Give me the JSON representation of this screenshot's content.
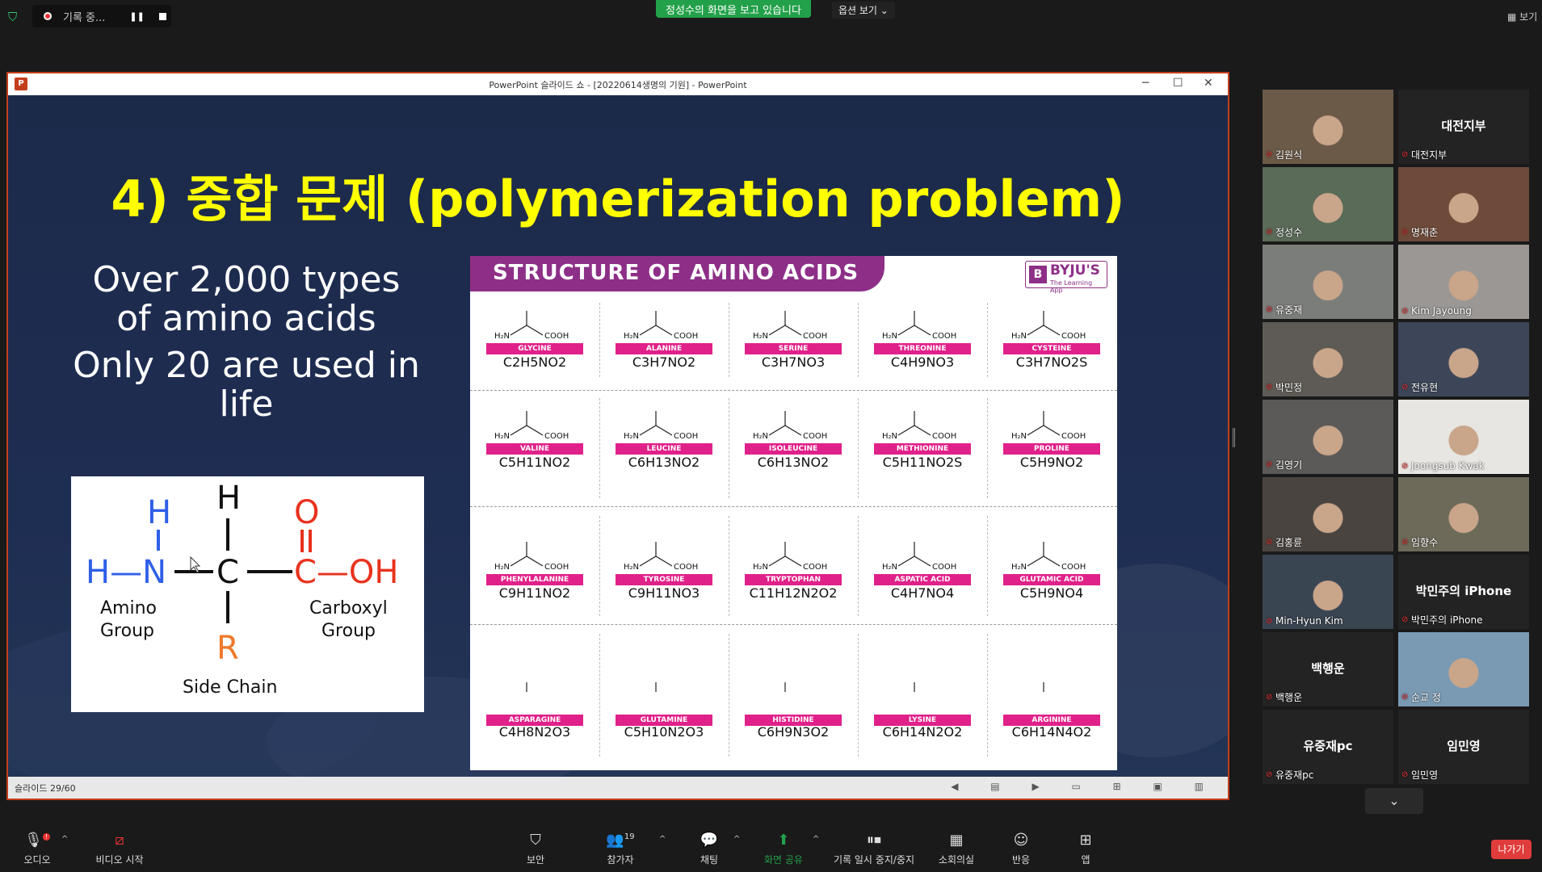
{
  "top": {
    "recording_label": "기록 중...",
    "sharing_banner": "정성수의 화면을 보고 있습니다",
    "view_options": "옵션 보기 ⌄",
    "view_button": "보기"
  },
  "ppt": {
    "window_title": "PowerPoint 슬라이드 쇼 - [20220614생명의 기원] - PowerPoint",
    "status_slide": "슬라이드 29/60",
    "slide_title": "4) 중합 문제 (polymerization problem)",
    "left_text_1": "Over 2,000 types of amino acids",
    "left_text_2": "Only 20 are used in life",
    "amino_diagram": {
      "h_top": "H",
      "h_n": "H",
      "h_left": "H—N",
      "c": "C",
      "o": "O",
      "c_oh": "C—OH",
      "r": "R",
      "amino": "Amino",
      "group1": "Group",
      "carboxyl": "Carboxyl",
      "group2": "Group",
      "side_chain": "Side Chain"
    },
    "chart": {
      "header": "STRUCTURE OF AMINO ACIDS",
      "brand": "BYJU'S",
      "brand_sub": "The Learning App",
      "acids": [
        {
          "name": "GLYCINE",
          "formula": "C2H5NO2"
        },
        {
          "name": "ALANINE",
          "formula": "C3H7NO2"
        },
        {
          "name": "SERINE",
          "formula": "C3H7NO3"
        },
        {
          "name": "THREONINE",
          "formula": "C4H9NO3"
        },
        {
          "name": "CYSTEINE",
          "formula": "C3H7NO2S"
        },
        {
          "name": "VALINE",
          "formula": "C5H11NO2"
        },
        {
          "name": "LEUCINE",
          "formula": "C6H13NO2"
        },
        {
          "name": "ISOLEUCINE",
          "formula": "C6H13NO2"
        },
        {
          "name": "METHIONINE",
          "formula": "C5H11NO2S"
        },
        {
          "name": "PROLINE",
          "formula": "C5H9NO2"
        },
        {
          "name": "PHENYLALANINE",
          "formula": "C9H11NO2"
        },
        {
          "name": "TYROSINE",
          "formula": "C9H11NO3"
        },
        {
          "name": "TRYPTOPHAN",
          "formula": "C11H12N2O2"
        },
        {
          "name": "ASPATIC ACID",
          "formula": "C4H7NO4"
        },
        {
          "name": "GLUTAMIC ACID",
          "formula": "C5H9NO4"
        },
        {
          "name": "ASPARAGINE",
          "formula": "C4H8N2O3"
        },
        {
          "name": "GLUTAMINE",
          "formula": "C5H10N2O3"
        },
        {
          "name": "HISTIDINE",
          "formula": "C6H9N3O2"
        },
        {
          "name": "LYSINE",
          "formula": "C6H14N2O2"
        },
        {
          "name": "ARGININE",
          "formula": "C6H14N4O2"
        }
      ]
    }
  },
  "participants": [
    {
      "name": "김원식",
      "big": "",
      "video": true
    },
    {
      "name": "대전지부",
      "big": "대전지부",
      "video": false
    },
    {
      "name": "정성수",
      "big": "",
      "video": true
    },
    {
      "name": "명재춘",
      "big": "",
      "video": true
    },
    {
      "name": "유중재",
      "big": "",
      "video": true
    },
    {
      "name": "Kim Jayoung",
      "big": "",
      "video": true
    },
    {
      "name": "박민정",
      "big": "",
      "video": true
    },
    {
      "name": "전유현",
      "big": "",
      "video": true
    },
    {
      "name": "김영기",
      "big": "",
      "video": true
    },
    {
      "name": "Joongsub Kwak",
      "big": "",
      "video": true
    },
    {
      "name": "김홍륜",
      "big": "",
      "video": true
    },
    {
      "name": "임향수",
      "big": "",
      "video": true
    },
    {
      "name": "Min-Hyun Kim",
      "big": "",
      "video": true
    },
    {
      "name": "박민주의 iPhone",
      "big": "박민주의 iPhone",
      "video": false
    },
    {
      "name": "백행운",
      "big": "백행운",
      "video": false
    },
    {
      "name": "순교 정",
      "big": "",
      "video": true
    },
    {
      "name": "유중재pc",
      "big": "유중재pc",
      "video": false
    },
    {
      "name": "임민영",
      "big": "임민영",
      "video": false
    }
  ],
  "toolbar": {
    "audio": "오디오",
    "video": "비디오 시작",
    "security": "보안",
    "participants": "참가자",
    "participants_count": "19",
    "chat": "채팅",
    "share": "화면 공유",
    "record": "기록 일시 중지/중지",
    "breakout": "소회의실",
    "reactions": "반응",
    "apps": "앱",
    "leave": "나가기",
    "audio_badge": "!"
  },
  "colors": {
    "accent": "#23a14a",
    "slide_title": "#ffff00",
    "chart_header": "#8d2f87",
    "tag": "#e0218a",
    "leave": "#e03c3c"
  }
}
